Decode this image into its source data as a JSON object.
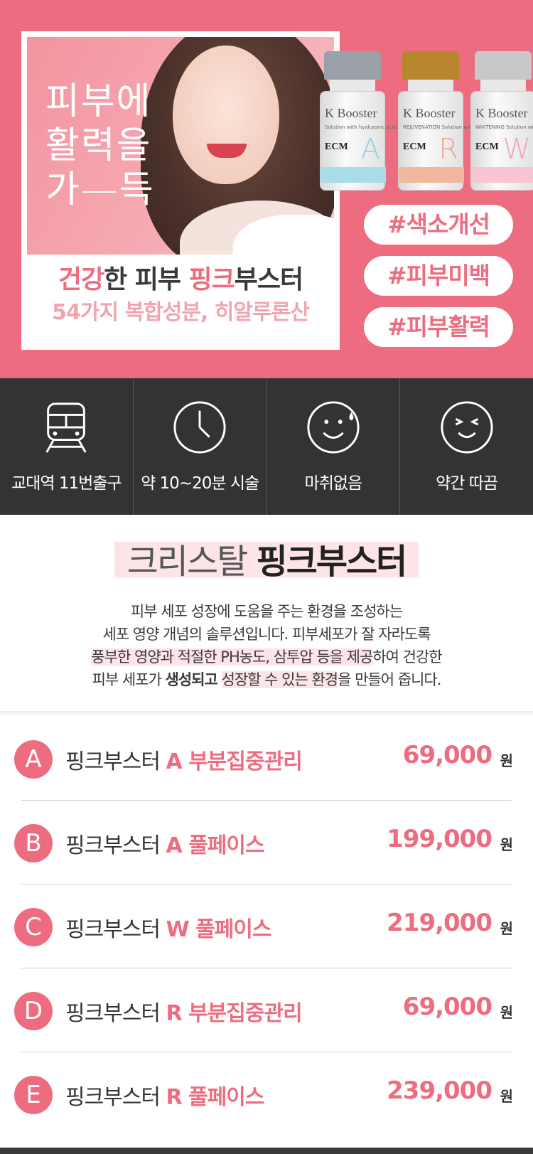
{
  "hero": {
    "slogan": [
      "피부에",
      "활력을",
      "가—득"
    ],
    "title_pink1": "건강",
    "title_mid1": "한 피부 ",
    "title_pink2": "핑크",
    "title_mid2": "부스터",
    "subtitle": "54가지 복합성분, 히알루론산",
    "vials": [
      {
        "brand": "K Booster",
        "line": "Solution with hyaluronic acid.",
        "ecm": "ECM",
        "letter": "A",
        "cap": "#9aa0a8",
        "band": "#a8dce6"
      },
      {
        "brand": "K Booster",
        "line": "REJUVENATION Solution with hyaluronic acid.",
        "ecm": "ECM",
        "letter": "R",
        "cap": "#b8862f",
        "band": "#f0b8a0"
      },
      {
        "brand": "K Booster",
        "line": "WHITENING Solution with hyaluronic acid.",
        "ecm": "ECM",
        "letter": "W",
        "cap": "#c8c8c8",
        "band": "#f7c6d2"
      }
    ],
    "tags": [
      "#색소개선",
      "#피부미백",
      "#피부활력"
    ]
  },
  "features": [
    {
      "icon": "train-icon",
      "label": "교대역 11번출구"
    },
    {
      "icon": "clock-icon",
      "label": "약 10~20분 시술"
    },
    {
      "icon": "smile-sweat-icon",
      "label": "마취없음"
    },
    {
      "icon": "squint-smile-icon",
      "label": "약간 따끔"
    }
  ],
  "intro": {
    "title_light": "크리스탈 ",
    "title_bold": "핑크부스터",
    "line1": "피부 세포 성장에 도움을 주는 환경을 조성하는",
    "line2": "세포 영양 개념의 솔루션입니다. 피부세포가 잘 자라도록",
    "line3_mark": "풍부한 영양과 적절한 PH농도, 삼투압 등을 제공",
    "line3_rest": "하여 건강한",
    "line4_a": "피부 세포가 ",
    "line4_b": "생성되고",
    "line4_c": " ",
    "line4_d": "성장할 수 있는 환경",
    "line4_e": "을 만들어 줍니다."
  },
  "prices": [
    {
      "letter": "A",
      "name": "핑크부스터 ",
      "highlight": "A 부분집중관리",
      "price": "69,000",
      "unit": "원"
    },
    {
      "letter": "B",
      "name": "핑크부스터 ",
      "highlight": "A 풀페이스",
      "price": "199,000",
      "unit": "원"
    },
    {
      "letter": "C",
      "name": "핑크부스터 ",
      "highlight": "W 풀페이스",
      "price": "219,000",
      "unit": "원"
    },
    {
      "letter": "D",
      "name": "핑크부스터 ",
      "highlight": "R 부분집중관리",
      "price": "69,000",
      "unit": "원"
    },
    {
      "letter": "E",
      "name": "핑크부스터 ",
      "highlight": "R 풀페이스",
      "price": "239,000",
      "unit": "원"
    }
  ],
  "colors": {
    "accent": "#ee6c7f",
    "dark": "#333333",
    "highlight_bg": "#fde4e8"
  }
}
